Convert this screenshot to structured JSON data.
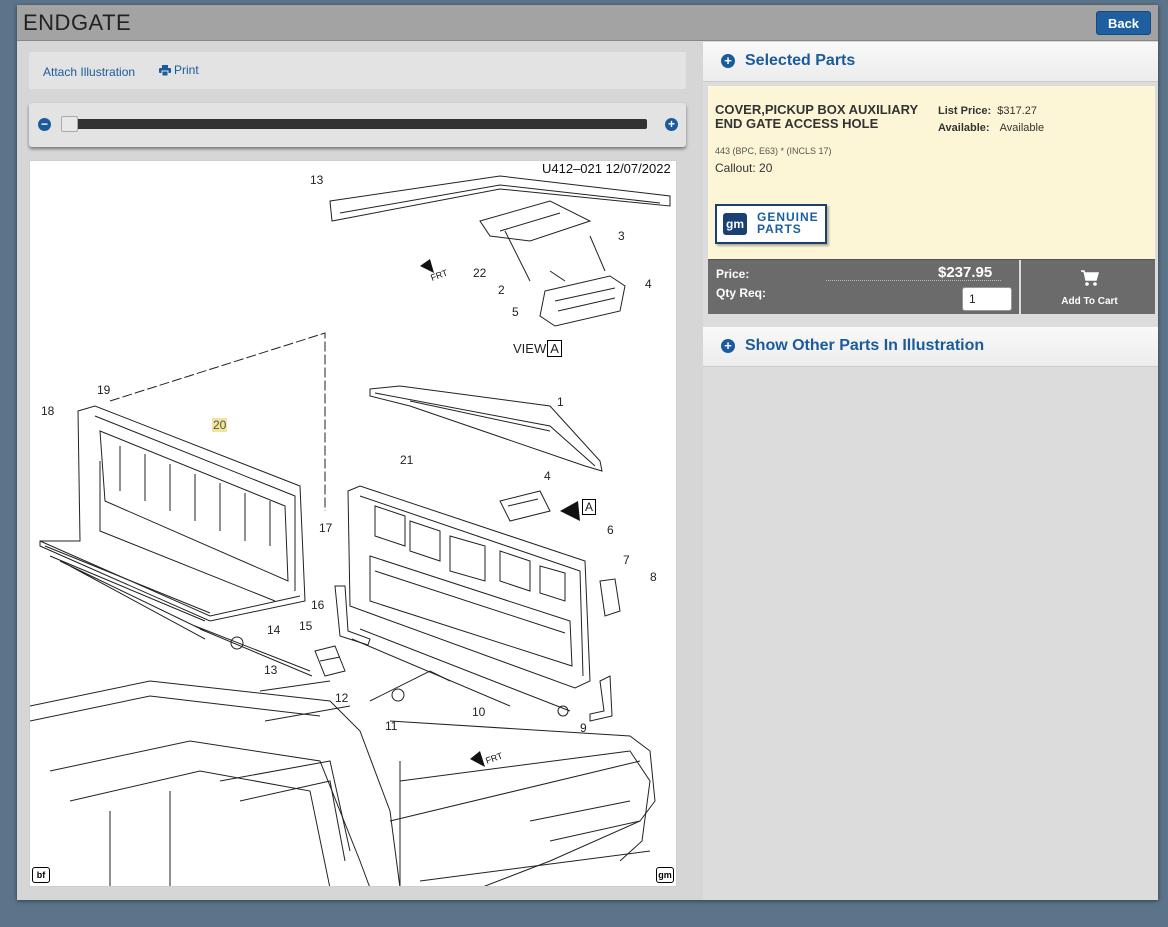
{
  "window": {
    "title": "ENDGATE",
    "back_label": "Back"
  },
  "toolbar": {
    "attach_label": "Attach Illustration",
    "print_label": "Print"
  },
  "zoom": {
    "minus": "−",
    "plus": "+",
    "level": 0
  },
  "illustration": {
    "stamp": "U412–021  12/07/2022",
    "view_label": "VIEW",
    "view_letter": "A",
    "arrow_letter": "A",
    "frt_label": "FRT",
    "corner_left": "bf",
    "corner_right": "gm",
    "callouts": [
      "13",
      "3",
      "22",
      "2",
      "5",
      "4",
      "19",
      "18",
      "20",
      "1",
      "21",
      "4",
      "17",
      "6",
      "7",
      "8",
      "16",
      "14",
      "15",
      "13",
      "12",
      "11",
      "10",
      "9"
    ],
    "highlighted_callout": "20"
  },
  "selected_parts": {
    "header": "Selected Parts",
    "part_name": "COVER,PICKUP BOX AUXILIARY END GATE ACCESS HOLE",
    "list_price_label": "List Price:",
    "list_price_value": "$317.27",
    "available_label": "Available:",
    "available_value": "Available",
    "meta": "443 (BPC, E63) * (INCLS 17)",
    "callout": "Callout: 20",
    "badge_logo": "gm",
    "badge_line1": "GENUINE",
    "badge_line2": "PARTS",
    "price_label": "Price:",
    "price_value": "$237.95",
    "qty_label": "Qty Req:",
    "qty_value": "1",
    "add_to_cart": "Add To Cart"
  },
  "other_parts": {
    "header": "Show Other Parts In Illustration"
  },
  "colors": {
    "accent": "#1b5b9b",
    "part_bg": "#fdf6d6",
    "price_bar": "#6b6b6b",
    "page_bg": "#5b7489",
    "highlight": "#f0e59a"
  }
}
